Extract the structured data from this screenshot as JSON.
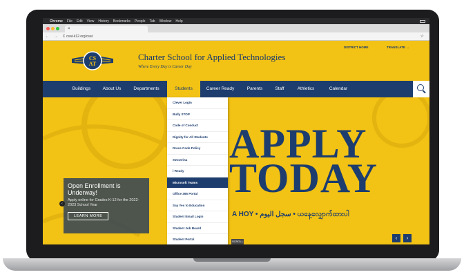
{
  "mac_menu": {
    "apple": "",
    "app": "Chrome",
    "items": [
      "File",
      "Edit",
      "View",
      "History",
      "Bookmarks",
      "People",
      "Tab",
      "Window",
      "Help"
    ]
  },
  "browser": {
    "tab_close": "×",
    "nav_glyphs": "← → C",
    "url": "csat-k12.org/csat",
    "star": "☆"
  },
  "header": {
    "title": "Charter School for Applied Technologies",
    "tagline": "Where Every Day is Career Day",
    "district_home": "DISTRICT HOME",
    "translate": "TRANSLATE →",
    "logo_letters": "CS AT"
  },
  "nav": {
    "items": [
      "Buildings",
      "About Us",
      "Departments",
      "Students",
      "Career Ready",
      "Parents",
      "Staff",
      "Athletics",
      "Calendar"
    ],
    "active": "Students"
  },
  "dropdown": {
    "items": [
      "Clever Login",
      "Bully STOP",
      "Code of Conduct",
      "Dignity for All Students",
      "Dress Code Policy",
      "eDoctrina",
      "i-Ready",
      "Microsoft Teams",
      "Office 365 Portal",
      "Say Yes to Education",
      "Student Email Login",
      "Student Job Board",
      "Student Portal"
    ],
    "highlighted": "Microsoft Teams"
  },
  "hero": {
    "line1": "APPLY",
    "line2": "TODAY",
    "multilang": "A HOY  •  سجل اليوم  •  ယနေ့လျှောက်ထားပါ"
  },
  "promo": {
    "title": "Open Enrollment is Underway!",
    "subtitle": "Apply online for Grades K-12 for the 2022-2023 School Year",
    "button": "LEARN MORE",
    "arrow": "‹"
  },
  "slider": {
    "scroll_label": "SCROLL",
    "prev": "‹",
    "next": "›"
  },
  "colors": {
    "brand_yellow": "#f2c214",
    "brand_navy": "#1d3d6e"
  }
}
